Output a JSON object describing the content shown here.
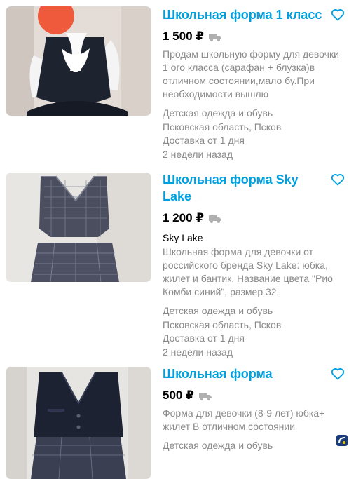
{
  "listings": [
    {
      "title": "Школьная форма 1 класс",
      "price": "1 500 ₽",
      "brand": "",
      "description": "Продам школьную форму для девочки 1 ого класса (сарафан + блузка)в отличном состоянии,мало бу.При необходимости вышлю",
      "category": "Детская одежда и обувь",
      "location": "Псковская область, Псков",
      "delivery": "Доставка от 1 дня",
      "posted": "2 недели назад",
      "delivery_icon": "truck-icon",
      "favorite_icon": "heart-outline-icon"
    },
    {
      "title": "Школьная форма Sky Lake",
      "price": "1 200 ₽",
      "brand": "Sky Lake",
      "description": "Школьная форма для девочки от российского бренда Sky Lake: юбка, жилет и бантик. Название цвета \"Рио Комби синий\", размер 32.",
      "category": "Детская одежда и обувь",
      "location": "Псковская область, Псков",
      "delivery": "Доставка от 1 дня",
      "posted": "2 недели назад",
      "delivery_icon": "truck-icon",
      "favorite_icon": "heart-outline-icon"
    },
    {
      "title": "Школьная форма",
      "price": "500 ₽",
      "brand": "",
      "description": "Форма для девочки (8-9 лет) юбка+ жилет В отличном состоянии",
      "category": "Детская одежда и обувь",
      "location": "",
      "delivery": "",
      "posted": "",
      "delivery_icon": "truck-icon",
      "favorite_icon": "heart-outline-icon"
    }
  ],
  "colors": {
    "title_link": "#00a0e0",
    "price": "#000000",
    "secondary_text": "#8a8a8a",
    "favorite_icon": "#00a0e0"
  }
}
